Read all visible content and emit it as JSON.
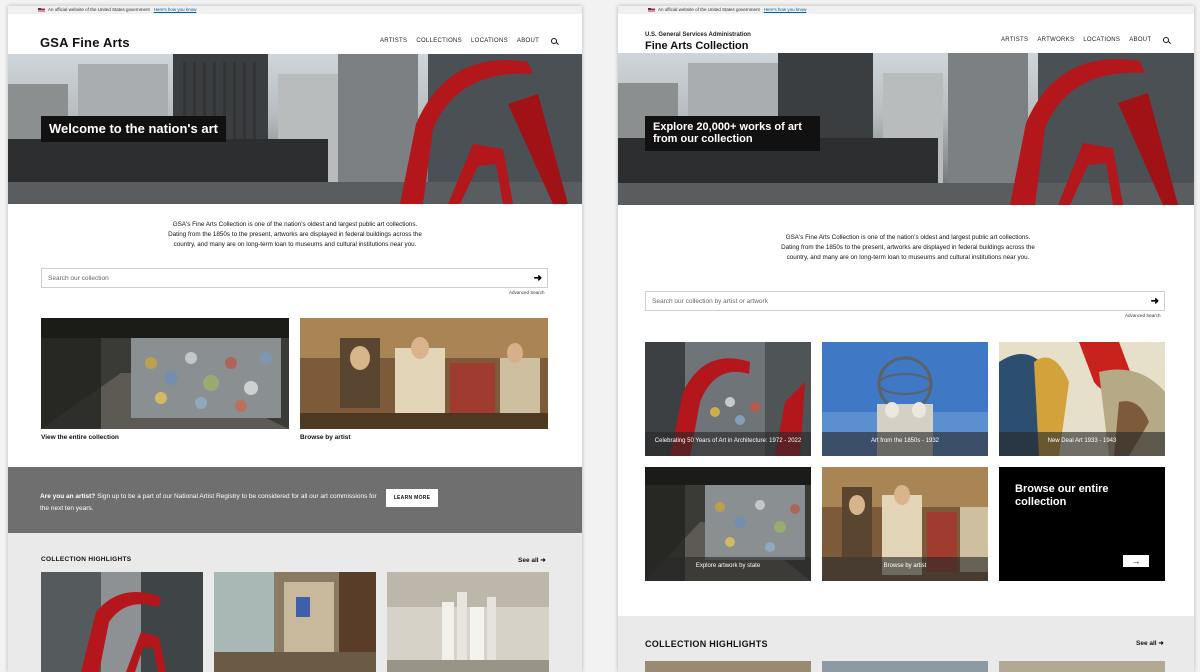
{
  "left": {
    "banner": {
      "text": "An official website of the United States government",
      "link": "Here's how you know"
    },
    "logo": "GSA Fine Arts",
    "nav": [
      "ARTISTS",
      "COLLECTIONS",
      "LOCATIONS",
      "ABOUT"
    ],
    "hero_title": "Welcome to the nation's art",
    "intro": "GSA's Fine Arts Collection is one of the nation's oldest and largest public art collections. Dating from the 1850s to the present, artworks are displayed in federal buildings across the country, and many are on long-term loan to museums and cultural institutions near you.",
    "search_placeholder": "Search our collection",
    "advanced_search": "Advanced Search",
    "tiles": [
      {
        "label": "View the entire collection"
      },
      {
        "label": "Browse by artist"
      }
    ],
    "artist_band": {
      "question": "Are you an artist?",
      "text": "Sign up to be a part of our National Artist Registry to be considered for all our art commissions for the next ten years.",
      "button": "LEARN MORE"
    },
    "highlights_title": "COLLECTION HIGHLIGHTS",
    "see_all": "See all"
  },
  "right": {
    "banner": {
      "text": "An official website of the United States government",
      "link": "Here's how you know"
    },
    "agency": "U.S. General Services Administration",
    "logo": "Fine Arts Collection",
    "nav": [
      "ARTISTS",
      "ARTWORKS",
      "LOCATIONS",
      "ABOUT"
    ],
    "hero_title": "Explore 20,000+ works of art from our collection",
    "intro": "GSA's Fine Arts Collection is one of the nation's oldest and largest public art collections. Dating from the 1850s to the present, artworks are displayed in federal buildings across the country, and many are on long-term loan to museums and cultural institutions near you.",
    "search_placeholder": "Search our collection by artist or artwork",
    "advanced_search": "Advanced Search",
    "tiles": [
      {
        "caption": "Celebrating 50 Years of Art in Architecture: 1972 - 2022"
      },
      {
        "caption": "Art from the 1850s - 1932"
      },
      {
        "caption": "New Deal Art 1933 - 1943"
      },
      {
        "caption": "Explore artwork by state"
      },
      {
        "caption": "Browse by artist"
      }
    ],
    "browse_all": "Browse our entire collection",
    "browse_arrow": "→",
    "highlights_title": "COLLECTION HIGHLIGHTS",
    "see_all": "See all"
  },
  "colors": {
    "flamingo_red": "#b3161b",
    "band_gray": "#6f6f6f",
    "black": "#000000"
  }
}
